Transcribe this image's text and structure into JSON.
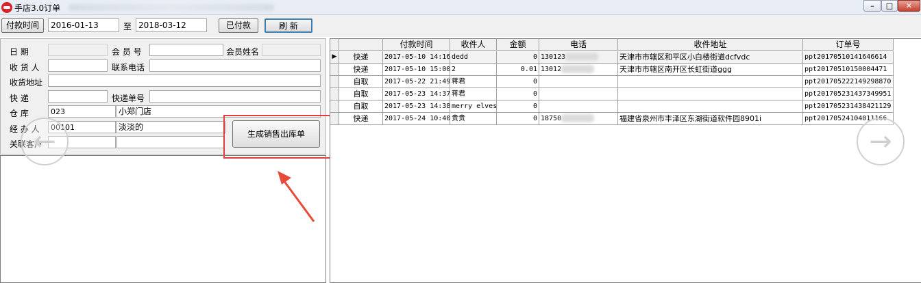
{
  "window": {
    "title": "手店3.0订单",
    "min_glyph": "–",
    "max_glyph": "□",
    "close_glyph": "✕"
  },
  "toolbar": {
    "pay_time_label": "付款时间",
    "date_from": "2016-01-13",
    "to_label": "至",
    "date_to": "2018-03-12",
    "paid_label": "已付款",
    "refresh_label": "刷  新"
  },
  "form": {
    "date_label": "日    期",
    "member_no_label": "会 员 号",
    "member_name_label": "会员姓名",
    "receiver_label": "收 货 人",
    "contact_phone_label": "联系电话",
    "address_label": "收货地址",
    "express_label": "快    递",
    "express_no_label": "快递单号",
    "warehouse_label": "仓    库",
    "warehouse_code": "023",
    "warehouse_name": "小郑门店",
    "handler_label": "经 办 人",
    "handler_code": "00101",
    "handler_name": "淡淡的",
    "related_customer_label": "关联客户",
    "generate_button_label": "生成销售出库单"
  },
  "grid": {
    "columns": [
      "",
      "付款时间",
      "收件人",
      "金额",
      "电话",
      "收件地址",
      "订单号"
    ],
    "rows": [
      {
        "type": "快递",
        "time": "2017-05-10 14:16",
        "receiver": "dedd",
        "amount": "0",
        "phone": "130123",
        "address": "天津市市辖区和平区小白楼街道dcfvdc",
        "order": "ppt20170510141646614"
      },
      {
        "type": "快递",
        "time": "2017-05-10 15:00",
        "receiver": "2",
        "amount": "0.01",
        "phone": "13012",
        "address": "天津市市辖区南开区长虹街道ggg",
        "order": "ppt20170510150004471"
      },
      {
        "type": "自取",
        "time": "2017-05-22 21:49",
        "receiver": "蒋君",
        "amount": "0",
        "phone": "",
        "address": "",
        "order": "ppt20170522214929887​0"
      },
      {
        "type": "自取",
        "time": "2017-05-23 14:37",
        "receiver": "蒋君",
        "amount": "0",
        "phone": "",
        "address": "",
        "order": "ppt20170523143734995​1"
      },
      {
        "type": "自取",
        "time": "2017-05-23 14:38",
        "receiver": "merry elves",
        "amount": "0",
        "phone": "",
        "address": "",
        "order": "ppt20170523143842112​9"
      },
      {
        "type": "快递",
        "time": "2017-05-24 10:40",
        "receiver": "贵贵",
        "amount": "0",
        "phone": "18750",
        "address": "福建省泉州市丰泽区东湖街道软件园8901i",
        "order": "ppt20170524104011166"
      }
    ]
  },
  "nav": {
    "prev_glyph": "←",
    "next_glyph": "→"
  }
}
